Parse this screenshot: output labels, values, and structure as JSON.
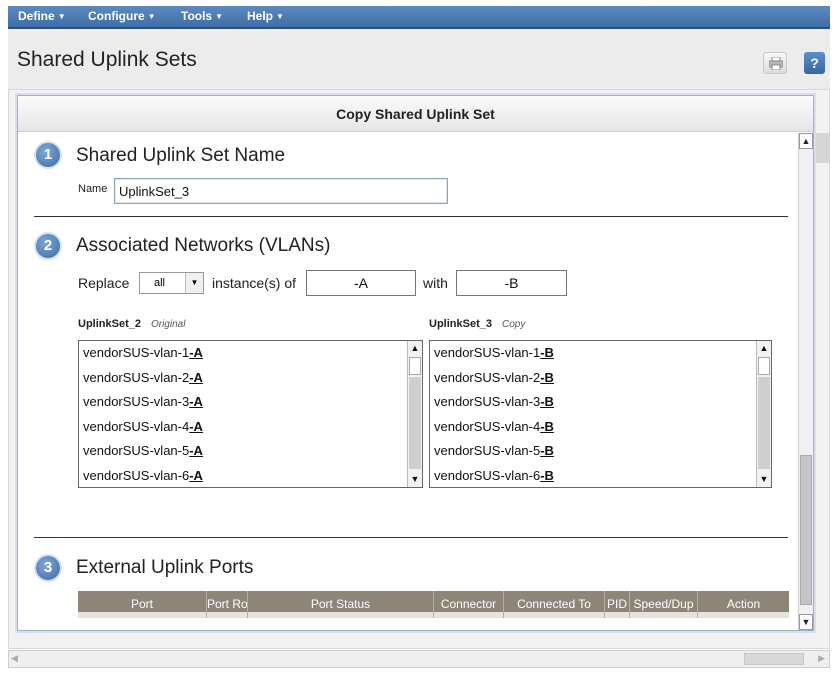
{
  "menubar": {
    "items": [
      {
        "label": "Define"
      },
      {
        "label": "Configure"
      },
      {
        "label": "Tools"
      },
      {
        "label": "Help"
      }
    ]
  },
  "page": {
    "title": "Shared Uplink Sets",
    "help_label": "?"
  },
  "dialog": {
    "title": "Copy Shared Uplink Set",
    "section1": {
      "number": "1",
      "heading": "Shared Uplink Set Name",
      "name_label": "Name",
      "name_value": "UplinkSet_3"
    },
    "section2": {
      "number": "2",
      "heading": "Associated Networks (VLANs)",
      "replace_label": "Replace",
      "replace_select": "all",
      "instances_label": "instance(s) of",
      "find_value": "-A",
      "with_label": "with",
      "replace_value": "-B",
      "original_list": {
        "name": "UplinkSet_2",
        "tag": "Original",
        "items": [
          {
            "base": "vendorSUS-vlan-1",
            "suffix": "-A"
          },
          {
            "base": "vendorSUS-vlan-2",
            "suffix": "-A"
          },
          {
            "base": "vendorSUS-vlan-3",
            "suffix": "-A"
          },
          {
            "base": "vendorSUS-vlan-4",
            "suffix": "-A"
          },
          {
            "base": "vendorSUS-vlan-5",
            "suffix": "-A"
          },
          {
            "base": "vendorSUS-vlan-6",
            "suffix": "-A"
          }
        ]
      },
      "copy_list": {
        "name": "UplinkSet_3",
        "tag": "Copy",
        "items": [
          {
            "base": "vendorSUS-vlan-1",
            "suffix": "-B"
          },
          {
            "base": "vendorSUS-vlan-2",
            "suffix": "-B"
          },
          {
            "base": "vendorSUS-vlan-3",
            "suffix": "-B"
          },
          {
            "base": "vendorSUS-vlan-4",
            "suffix": "-B"
          },
          {
            "base": "vendorSUS-vlan-5",
            "suffix": "-B"
          },
          {
            "base": "vendorSUS-vlan-6",
            "suffix": "-B"
          }
        ]
      }
    },
    "section3": {
      "number": "3",
      "heading": "External Uplink Ports",
      "columns": [
        "Port",
        "Port Ro",
        "Port Status",
        "Connector",
        "Connected To",
        "PID",
        "Speed/Dup",
        "Action"
      ]
    }
  },
  "colors": {
    "menubar": "#4a79b4",
    "table_header": "#8e8579",
    "badge": "#4d7ab3"
  }
}
